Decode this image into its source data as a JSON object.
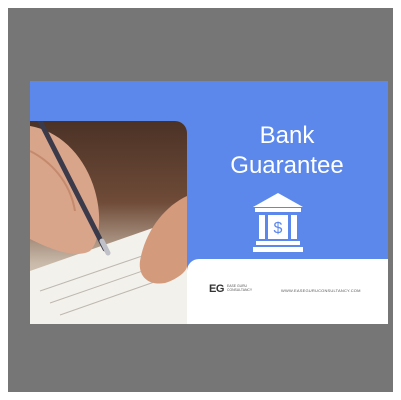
{
  "banner": {
    "title_line1": "Bank",
    "title_line2": "Guarantee",
    "icon": "bank-dollar-icon",
    "photo": "hand-signing-document-photo",
    "colors": {
      "background": "#5c88ec",
      "frame": "#767676",
      "footer": "#ffffff"
    }
  },
  "footer": {
    "logo_mark": "EG",
    "logo_text": "Ease Guru Consultancy",
    "website": "WWW.EASEGURUCONSULTANCY.COM"
  }
}
